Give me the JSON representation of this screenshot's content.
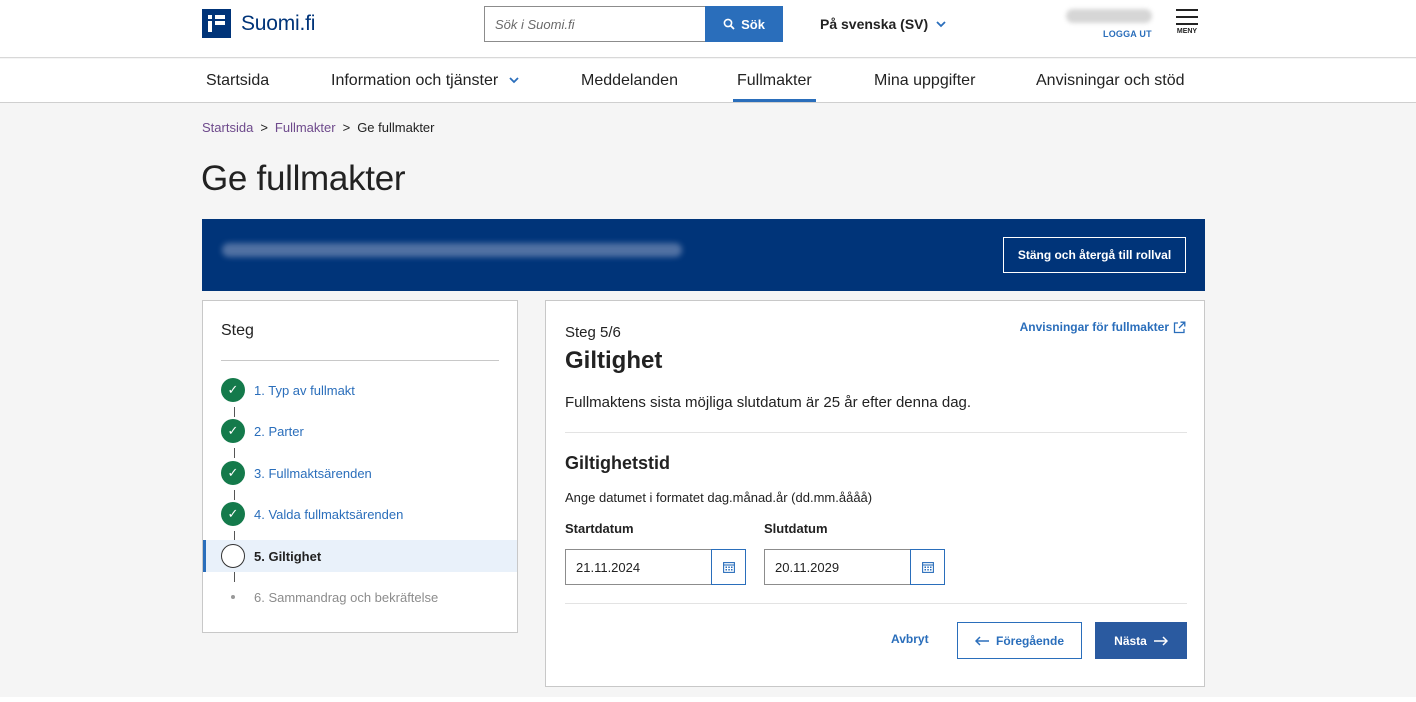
{
  "header": {
    "logo_text": "Suomi.fi",
    "search_placeholder": "Sök i Suomi.fi",
    "search_button": "Sök",
    "language": "På svenska (SV)",
    "logout": "LOGGA UT",
    "menu": "MENY"
  },
  "nav": {
    "items": [
      {
        "label": "Startsida"
      },
      {
        "label": "Information och tjänster"
      },
      {
        "label": "Meddelanden"
      },
      {
        "label": "Fullmakter"
      },
      {
        "label": "Mina uppgifter"
      },
      {
        "label": "Anvisningar och stöd"
      }
    ],
    "active": "Fullmakter"
  },
  "breadcrumb": {
    "items": [
      "Startsida",
      "Fullmakter",
      "Ge fullmakter"
    ],
    "separator": ">"
  },
  "page": {
    "title": "Ge fullmakter"
  },
  "banner": {
    "close_button": "Stäng och återgå till rollval"
  },
  "steps": {
    "title": "Steg",
    "items": [
      {
        "label": "1. Typ av fullmakt",
        "status": "done"
      },
      {
        "label": "2. Parter",
        "status": "done"
      },
      {
        "label": "3. Fullmaktsärenden",
        "status": "done"
      },
      {
        "label": "4. Valda fullmaktsärenden",
        "status": "done"
      },
      {
        "label": "5. Giltighet",
        "status": "current"
      },
      {
        "label": "6. Sammandrag och bekräftelse",
        "status": "upcoming"
      }
    ]
  },
  "main": {
    "step_count": "Steg 5/6",
    "help_link": "Anvisningar för fullmakter",
    "title": "Giltighet",
    "description": "Fullmaktens sista möjliga slutdatum är 25 år efter denna dag.",
    "section_title": "Giltighetstid",
    "hint": "Ange datumet i formatet dag.månad.år (dd.mm.åååå)",
    "start_label": "Startdatum",
    "start_value": "21.11.2024",
    "end_label": "Slutdatum",
    "end_value": "20.11.2029",
    "cancel": "Avbryt",
    "previous": "Föregående",
    "next": "Nästa"
  },
  "colors": {
    "brand": "#003479",
    "link": "#2a6ebb",
    "success": "#147a4b",
    "breadcrumb_link": "#6e4a8c"
  }
}
